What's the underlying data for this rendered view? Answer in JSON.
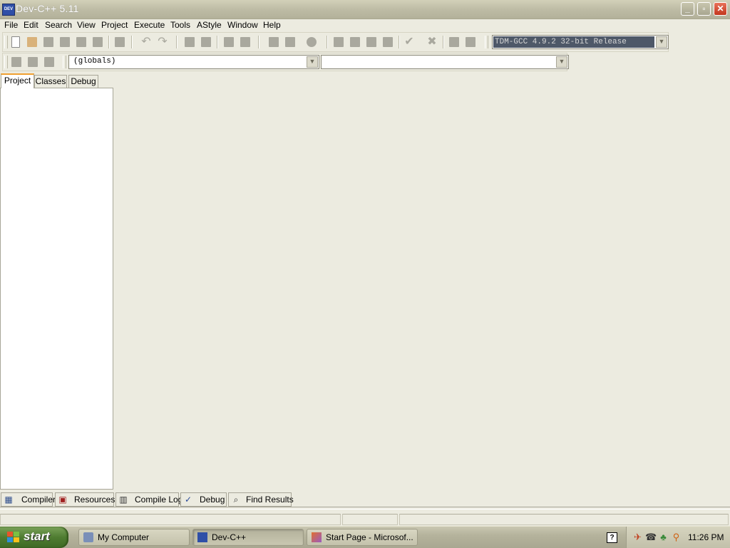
{
  "window": {
    "title": "Dev-C++ 5.11",
    "icon_text": "DEV"
  },
  "menu": [
    "File",
    "Edit",
    "Search",
    "View",
    "Project",
    "Execute",
    "Tools",
    "AStyle",
    "Window",
    "Help"
  ],
  "toolbar": {
    "compiler_selected": "TDM-GCC 4.9.2 32-bit Release",
    "scope_selected": "(globals)",
    "member_selected": ""
  },
  "left_tabs": [
    "Project",
    "Classes",
    "Debug"
  ],
  "bottom_tabs": [
    "Compiler",
    "Resources",
    "Compile Log",
    "Debug",
    "Find Results"
  ],
  "taskbar": {
    "start_label": "start",
    "items": [
      "My Computer",
      "Dev-C++",
      "Start Page - Microsof..."
    ],
    "help_glyph": "?",
    "clock": "11:26 PM"
  },
  "colors": {
    "accent_tab": "#f0a030",
    "compiler_bg": "#4e5868",
    "start_green": "#4f7c31"
  }
}
